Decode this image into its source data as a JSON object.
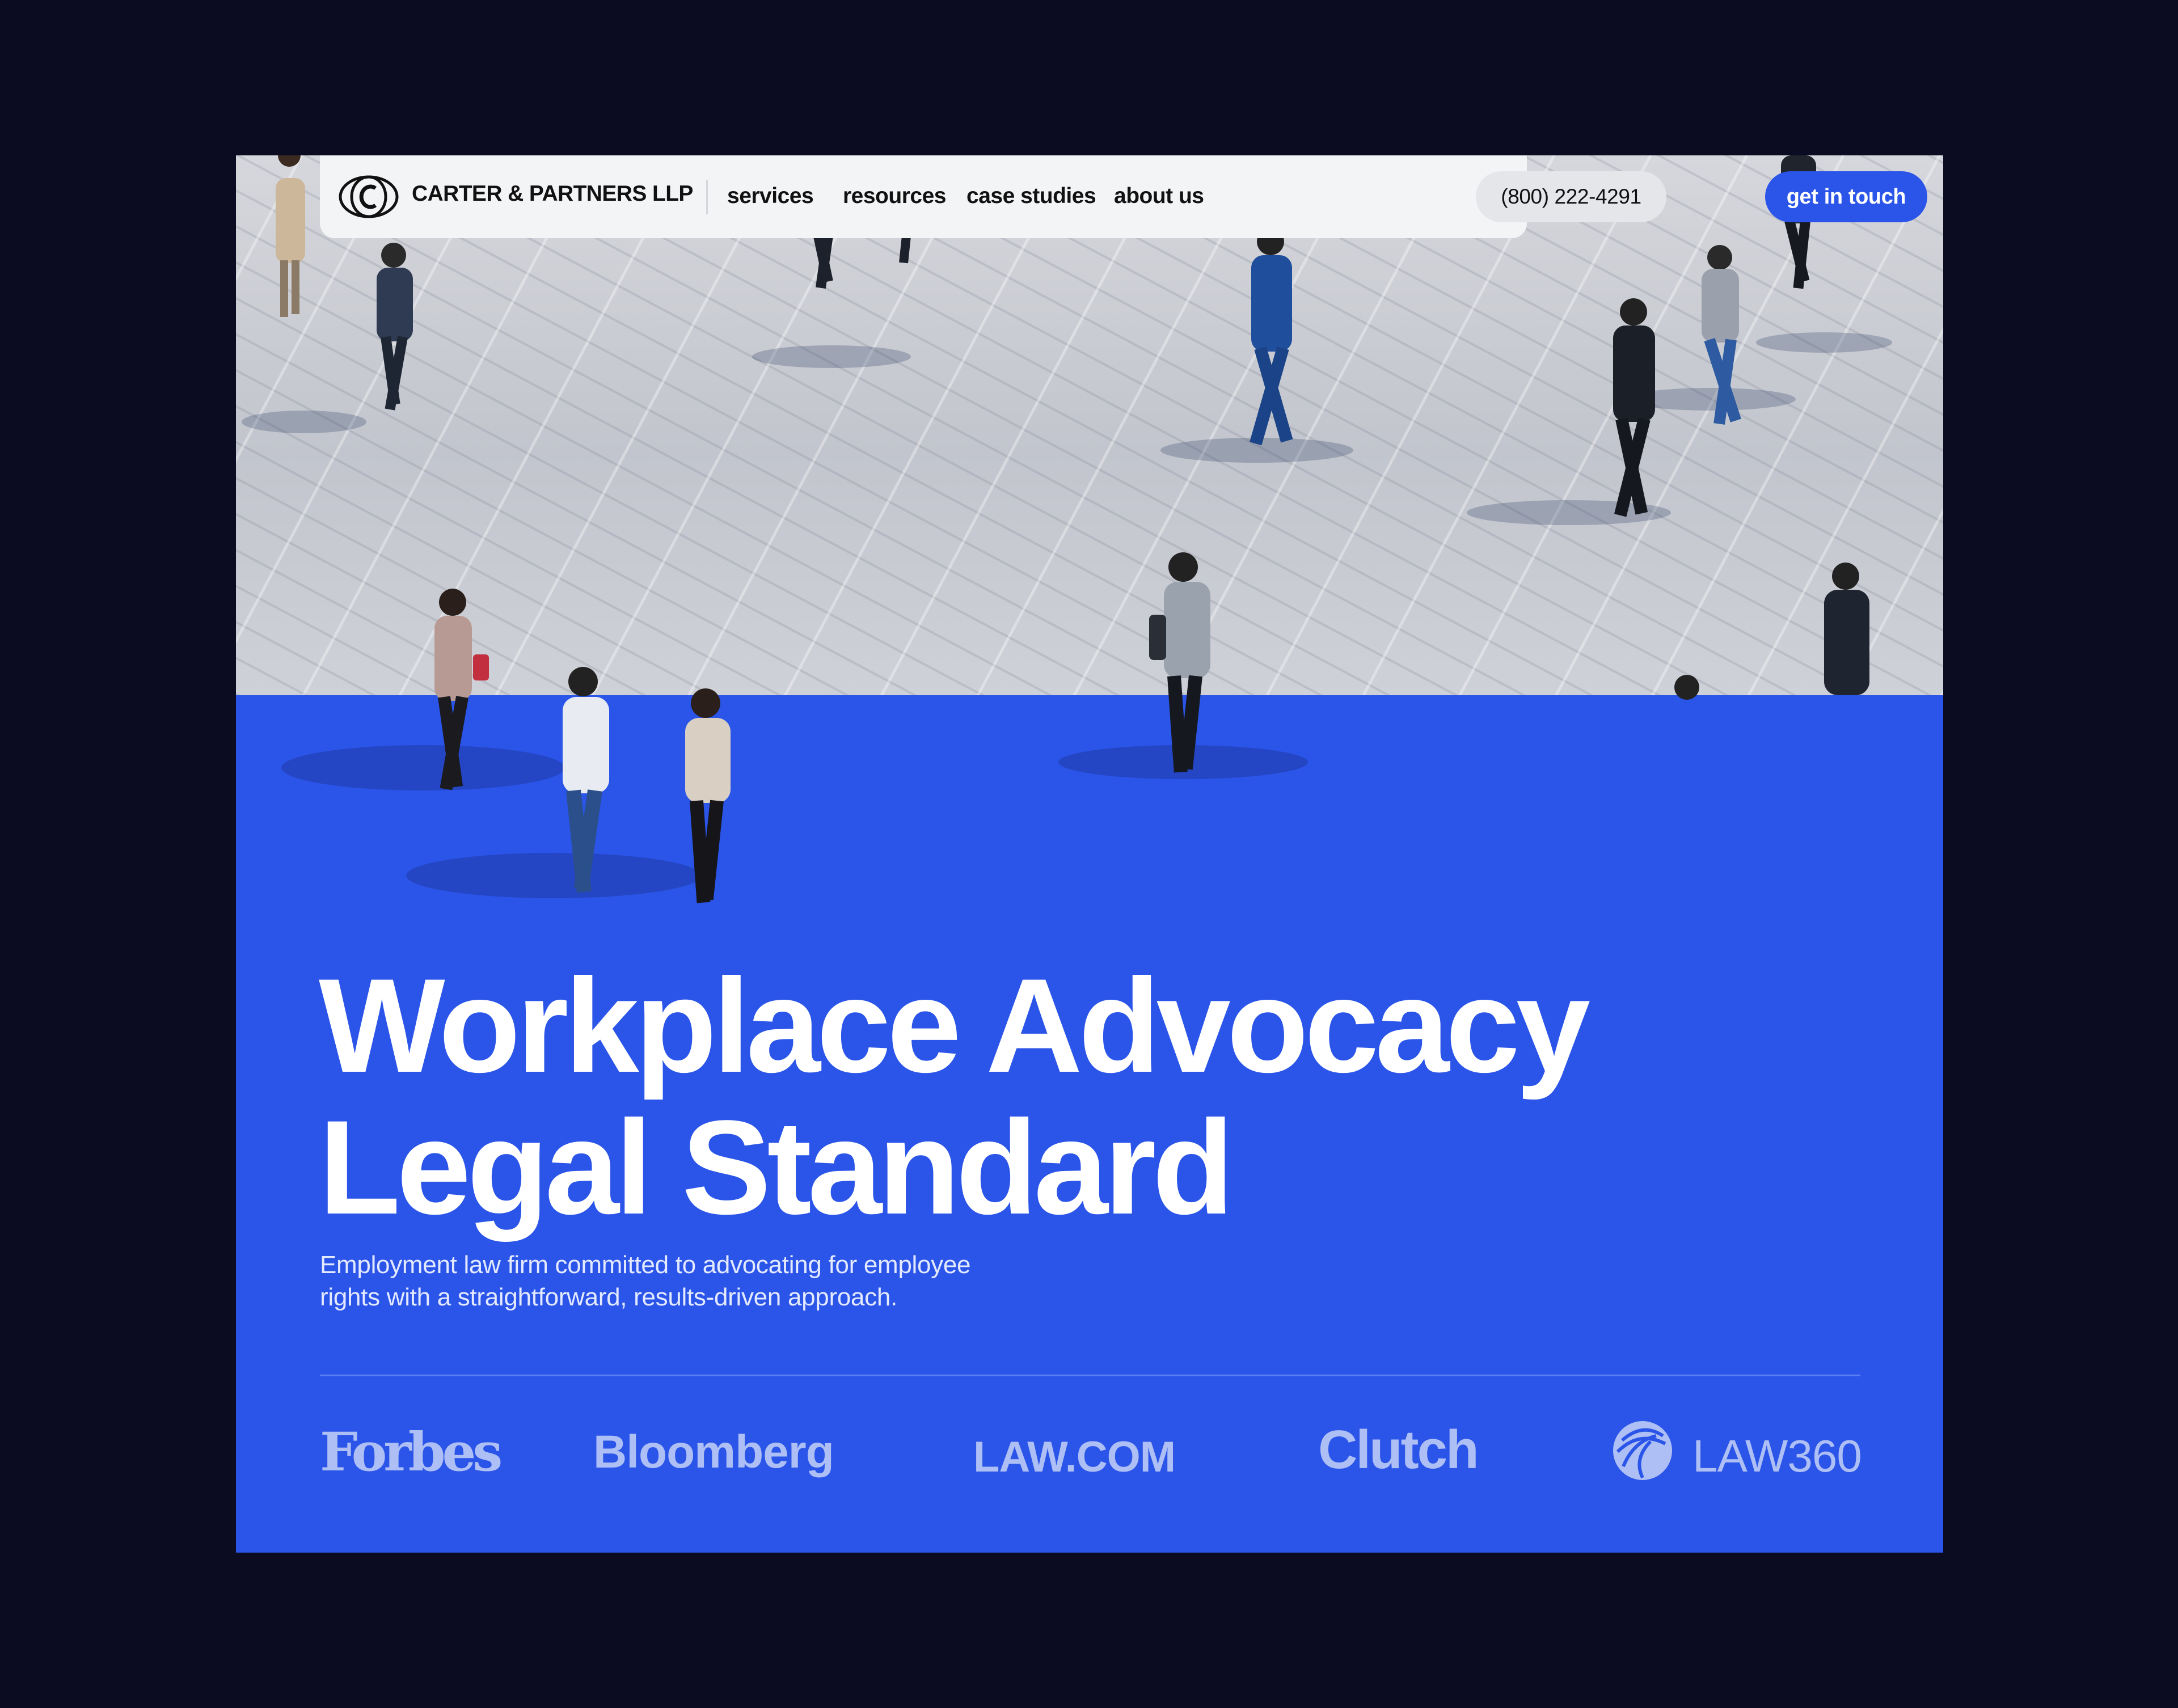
{
  "nav": {
    "brand": "CARTER & PARTNERS LLP",
    "links": [
      "services",
      "resources",
      "case studies",
      "about us"
    ],
    "phone": "(800) 222-4291",
    "cta": "get in touch"
  },
  "hero": {
    "headline_line1": "Workplace Advocacy",
    "headline_line2": "Legal Standard",
    "subtitle_line1": "Employment law firm committed to advocating for employee",
    "subtitle_line2": "rights with a straightforward, results-driven approach."
  },
  "press": {
    "logos": [
      "Forbes",
      "Bloomberg",
      "LAW.COM",
      "Clutch",
      "LAW360"
    ]
  },
  "colors": {
    "background": "#0b0c22",
    "accent": "#2b55e8",
    "nav_bg": "#f3f4f6",
    "press_logo": "#aebff5"
  },
  "icons": {
    "logo": "circle-c-logo-icon",
    "law360": "law360-globe-icon"
  }
}
